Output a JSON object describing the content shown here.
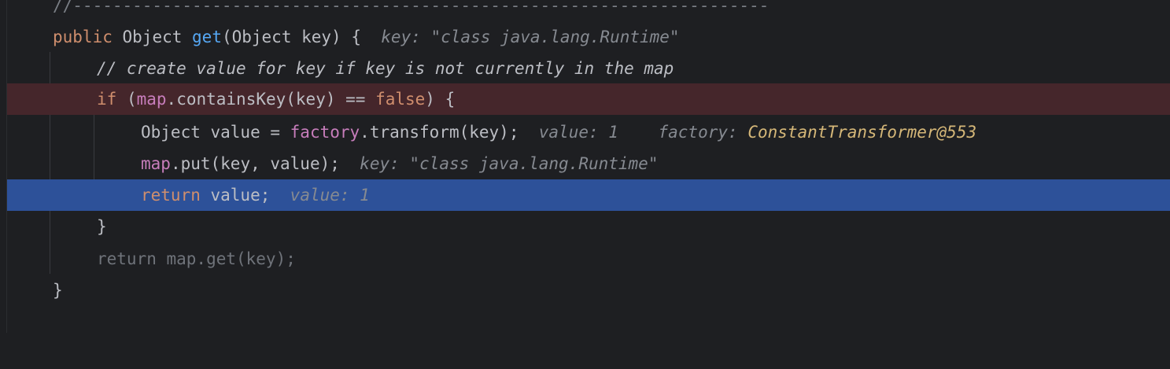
{
  "editor": {
    "lines": [
      {
        "id": "separator",
        "text": "//----------------------------------------------------------------------"
      },
      {
        "id": "signature",
        "kw": "public",
        "type": "Object",
        "fn": "get",
        "params": "(Object key) {",
        "hint": "key: \"class java.lang.Runtime\""
      },
      {
        "id": "comment",
        "text": "// create value for key if key is not currently in the map"
      },
      {
        "id": "if",
        "kw": "if",
        "open": "(",
        "field": "map",
        "rest": ".containsKey(key) == ",
        "kw2": "false",
        "close": ") {"
      },
      {
        "id": "assign",
        "pre": "Object value = ",
        "field": "factory",
        "rest": ".transform(key);",
        "hint1": "value: 1",
        "hint2_label": "factory:",
        "hint2_value": "ConstantTransformer@553"
      },
      {
        "id": "put",
        "field": "map",
        "rest": ".put(key, value);",
        "hint": "key: \"class java.lang.Runtime\""
      },
      {
        "id": "return-value",
        "kw": "return",
        "rest": " value;",
        "hint": "value: 1"
      },
      {
        "id": "close-if",
        "text": "}"
      },
      {
        "id": "return-get",
        "text": "return map.get(key);"
      },
      {
        "id": "close-method",
        "text": "}"
      }
    ]
  },
  "colors": {
    "background": "#1e1f22",
    "breakpoint_line": "#45262b",
    "execution_line": "#2d5199",
    "keyword": "#cf8e6d",
    "function": "#56a8f5",
    "field": "#c77dbb",
    "hint_value": "#d5b778"
  }
}
